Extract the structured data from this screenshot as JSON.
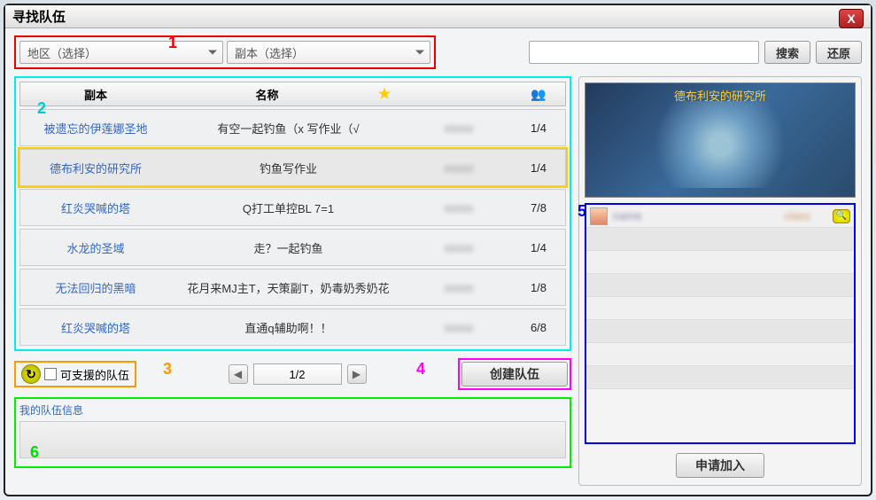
{
  "window": {
    "title": "寻找队伍"
  },
  "filters": {
    "region_placeholder": "地区（选择）",
    "dungeon_placeholder": "副本（选择）",
    "search_btn": "搜索",
    "reset_btn": "还原"
  },
  "headers": {
    "dungeon": "副本",
    "name": "名称",
    "star": "★",
    "people": "👥"
  },
  "parties": [
    {
      "dungeon": "被遗忘的伊莲娜圣地",
      "name": "有空一起钓鱼（x  写作业（√",
      "count": "1/4",
      "selected": false
    },
    {
      "dungeon": "德布利安的研究所",
      "name": "钓鱼写作业",
      "count": "1/4",
      "selected": true
    },
    {
      "dungeon": "红炎哭喊的塔",
      "name": "Q打工单控BL  7=1",
      "count": "7/8",
      "selected": false
    },
    {
      "dungeon": "水龙的圣域",
      "name": "走？一起钓鱼",
      "count": "1/4",
      "selected": false
    },
    {
      "dungeon": "无法回归的黑暗",
      "name": "花月来MJ主T，天策副T，奶毒奶秀奶花",
      "count": "1/8",
      "selected": false
    },
    {
      "dungeon": "红炎哭喊的塔",
      "name": "直通q辅助啊！！",
      "count": "6/8",
      "selected": false
    }
  ],
  "support": {
    "label": "可支援的队伍",
    "icon": "↻"
  },
  "pager": {
    "page": "1/2"
  },
  "create_btn": "创建队伍",
  "my_party": {
    "label": "我的队伍信息"
  },
  "preview": {
    "title": "德布利安的研究所"
  },
  "member": {
    "mag_icon": "🔍"
  },
  "apply_btn": "申请加入",
  "annotations": {
    "n1": "1",
    "n2": "2",
    "n3": "3",
    "n4": "4",
    "n5": "5",
    "n6": "6"
  }
}
